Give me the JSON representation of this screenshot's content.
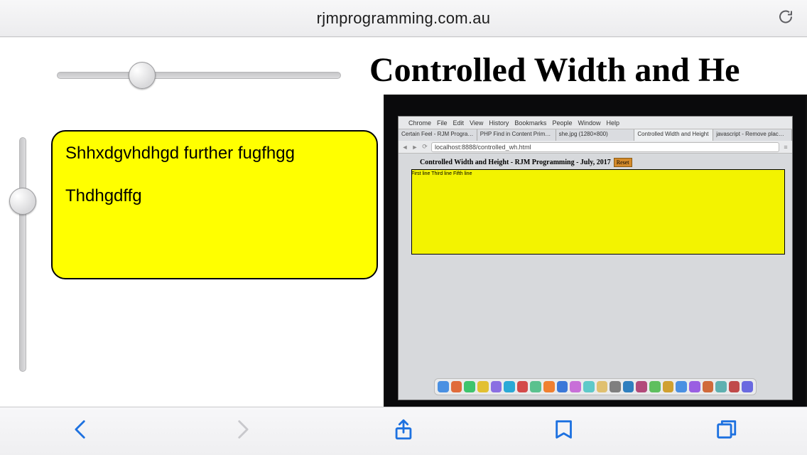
{
  "browser": {
    "domain": "rjmprogramming.com.au"
  },
  "page": {
    "title": "Controlled Width and He",
    "textarea_value": "Shhxdgvhdhgd further fugfhgg\n\nThdhgdffg"
  },
  "photo": {
    "menubar": [
      "Chrome",
      "File",
      "Edit",
      "View",
      "History",
      "Bookmarks",
      "People",
      "Window",
      "Help"
    ],
    "tabs": [
      {
        "label": "Certain Feel - RJM Programm…"
      },
      {
        "label": "PHP Find in Content Primer …"
      },
      {
        "label": "she.jpg (1280×800)"
      },
      {
        "label": "Controlled Width and Height"
      },
      {
        "label": "javascript - Remove plac…"
      }
    ],
    "address": "localhost:8888/controlled_wh.html",
    "inner_title": "Controlled Width and Height - RJM Programming - July, 2017",
    "inner_button": "Reset",
    "inner_lines": "First line\n\nThird line\n\nFifth line",
    "dock_colors": [
      "#4a90e2",
      "#e06b3a",
      "#3ec46d",
      "#e2c031",
      "#8a6fe2",
      "#2aa9d6",
      "#d44a4a",
      "#5ac18e",
      "#f08030",
      "#3b78d8",
      "#c86fd8",
      "#5ec9c9",
      "#e0c070",
      "#7f7f7f",
      "#2f7fbf",
      "#b24a7a",
      "#5fbf5f",
      "#d0a030",
      "#4a90e2",
      "#9a5fe2",
      "#d06a3a",
      "#5fb0b0",
      "#c04a4a",
      "#6a6ae0"
    ]
  }
}
